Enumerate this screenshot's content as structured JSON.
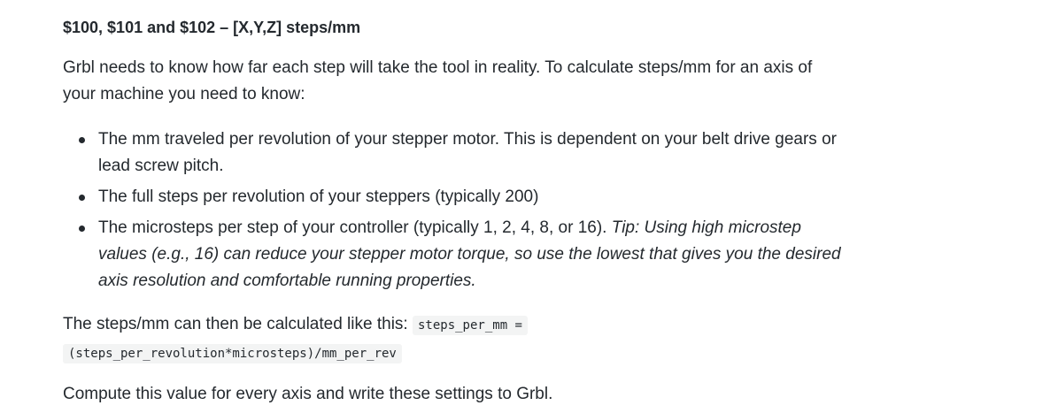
{
  "heading": "$100, $101 and $102 – [X,Y,Z] steps/mm",
  "intro": "Grbl needs to know how far each step will take the tool in reality. To calculate steps/mm for an axis of your machine you need to know:",
  "list": {
    "item1": "The mm traveled per revolution of your stepper motor. This is dependent on your belt drive gears or lead screw pitch.",
    "item2": "The full steps per revolution of your steppers (typically 200)",
    "item3": "The microsteps per step of your controller (typically 1, 2, 4, 8, or 16). ",
    "item3_tip": "Tip: Using high microstep values (e.g., 16) can reduce your stepper motor torque, so use the lowest that gives you the desired axis resolution and comfortable running properties."
  },
  "calc": {
    "text": "The steps/mm can then be calculated like this: ",
    "code_part1": "steps_per_mm =",
    "code_part2": "(steps_per_revolution*microsteps)/mm_per_rev"
  },
  "final": "Compute this value for every axis and write these settings to Grbl."
}
